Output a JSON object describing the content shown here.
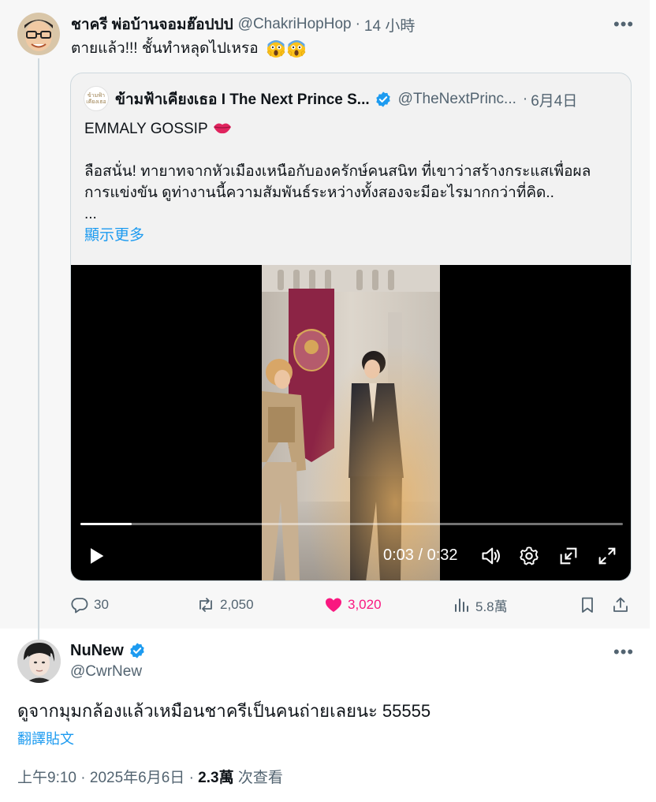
{
  "reply": {
    "author_name": "ชาครี พ่อบ้านจอมฮ๊อปปป",
    "author_handle": "@ChakriHopHop",
    "separator": "·",
    "time": "14 小時",
    "text": "ตายแล้ว!!! ชั้นทำหลุดไปเหรอ",
    "emojis": [
      "screaming-face-icon",
      "screaming-face-icon"
    ]
  },
  "quote": {
    "author_name": "ข้ามฟ้าเคียงเธอ I The Next Prince S...",
    "avatar_text": "ข้ามฟ้า เคียงเธอ",
    "author_handle": "@TheNextPrinc...",
    "separator": "·",
    "date": "6月4日",
    "title_line": "EMMALY GOSSIP",
    "body_line1": "ลือสนั่น! ทายาทจากหัวเมืองเหนือกับองครักษ์คนสนิท ที่เขาว่าสร้างกระแสเพื่อผล",
    "body_line2": "การแข่งขัน ดูท่างานนี้ความสัมพันธ์ระหว่างทั้งสองจะมีอะไรมากกว่าที่คิด..",
    "ellipsis": "...",
    "show_more": "顯示更多",
    "video": {
      "current_time": "0:03",
      "duration": "0:32",
      "time_label": "0:03 / 0:32",
      "progress": 0.094
    }
  },
  "actions": {
    "replies": "30",
    "reposts": "2,050",
    "likes": "3,020",
    "views": "5.8萬"
  },
  "main_post": {
    "author_name": "NuNew",
    "author_handle": "@CwrNew",
    "text": "ดูจากมุมกล้องแล้วเหมือนชาครีเป็นคนถ่ายเลยนะ 55555",
    "translate": "翻譯貼文",
    "time": "上午9:10",
    "separator": "·",
    "date": "2025年6月6日",
    "views_count": "2.3萬",
    "views_label": "次查看"
  },
  "colors": {
    "accent": "#1d9bf0",
    "like": "#f91880",
    "muted": "#536471",
    "text": "#0f1419",
    "reply_bg": "#f7f7f7"
  }
}
